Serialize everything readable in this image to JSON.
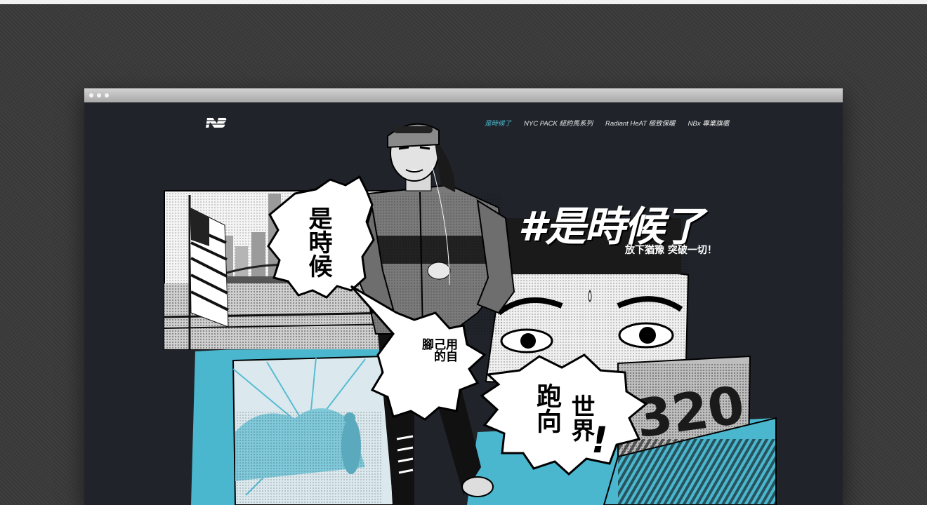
{
  "nav": {
    "items": [
      "是時候了",
      "NYC PACK 紐約馬系列",
      "Radiant HeAT 極致保暖",
      "NBx 專業旗艦"
    ],
    "active_index": 0
  },
  "hero": {
    "headline": "#是時候了",
    "subheadline": "放下猶豫  突破一切！"
  },
  "bubbles": {
    "first": "是時候",
    "second": "用自己的腳",
    "third_a": "跑向",
    "third_b": "世界",
    "third_mark": "!"
  },
  "bib_number": "320",
  "colors": {
    "accent": "#4ab7cf",
    "page_bg": "#20242a",
    "backdrop": "#3a3a3a"
  },
  "icons": {
    "brand_logo": "new-balance-logo-icon"
  }
}
